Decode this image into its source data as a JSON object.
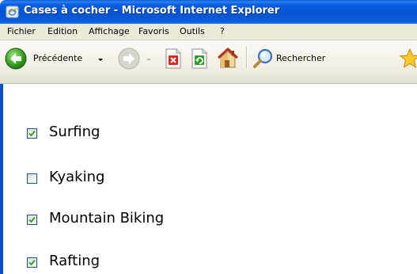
{
  "window": {
    "title": "Cases à cocher - Microsoft Internet Explorer"
  },
  "menu": {
    "items": [
      "Fichier",
      "Edition",
      "Affichage",
      "Favoris",
      "Outils",
      "?"
    ]
  },
  "toolbar": {
    "back_label": "Précédente",
    "search_label": "Rechercher"
  },
  "checkboxes": [
    {
      "label": "Surfing",
      "checked": true
    },
    {
      "label": "Kyaking",
      "checked": false
    },
    {
      "label": "Mountain Biking",
      "checked": true
    },
    {
      "label": "Rafting",
      "checked": true
    }
  ]
}
